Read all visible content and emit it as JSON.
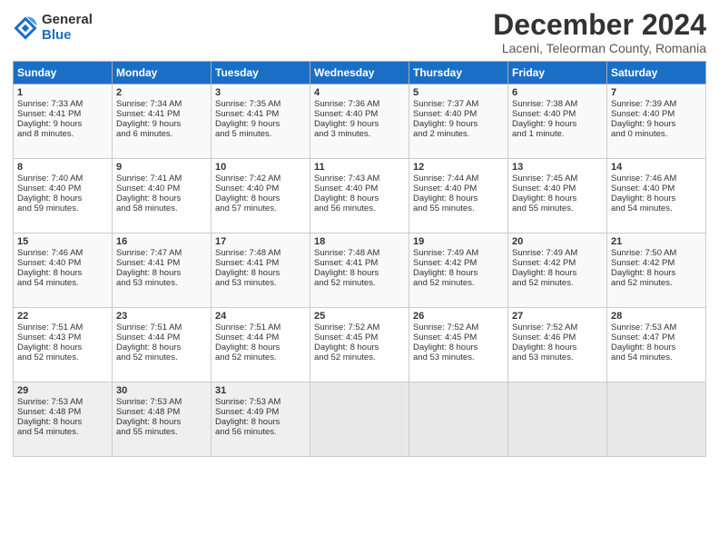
{
  "logo": {
    "general": "General",
    "blue": "Blue"
  },
  "title": "December 2024",
  "location": "Laceni, Teleorman County, Romania",
  "headers": [
    "Sunday",
    "Monday",
    "Tuesday",
    "Wednesday",
    "Thursday",
    "Friday",
    "Saturday"
  ],
  "weeks": [
    [
      {
        "day": "1",
        "lines": [
          "Sunrise: 7:33 AM",
          "Sunset: 4:41 PM",
          "Daylight: 9 hours",
          "and 8 minutes."
        ]
      },
      {
        "day": "2",
        "lines": [
          "Sunrise: 7:34 AM",
          "Sunset: 4:41 PM",
          "Daylight: 9 hours",
          "and 6 minutes."
        ]
      },
      {
        "day": "3",
        "lines": [
          "Sunrise: 7:35 AM",
          "Sunset: 4:41 PM",
          "Daylight: 9 hours",
          "and 5 minutes."
        ]
      },
      {
        "day": "4",
        "lines": [
          "Sunrise: 7:36 AM",
          "Sunset: 4:40 PM",
          "Daylight: 9 hours",
          "and 3 minutes."
        ]
      },
      {
        "day": "5",
        "lines": [
          "Sunrise: 7:37 AM",
          "Sunset: 4:40 PM",
          "Daylight: 9 hours",
          "and 2 minutes."
        ]
      },
      {
        "day": "6",
        "lines": [
          "Sunrise: 7:38 AM",
          "Sunset: 4:40 PM",
          "Daylight: 9 hours",
          "and 1 minute."
        ]
      },
      {
        "day": "7",
        "lines": [
          "Sunrise: 7:39 AM",
          "Sunset: 4:40 PM",
          "Daylight: 9 hours",
          "and 0 minutes."
        ]
      }
    ],
    [
      {
        "day": "8",
        "lines": [
          "Sunrise: 7:40 AM",
          "Sunset: 4:40 PM",
          "Daylight: 8 hours",
          "and 59 minutes."
        ]
      },
      {
        "day": "9",
        "lines": [
          "Sunrise: 7:41 AM",
          "Sunset: 4:40 PM",
          "Daylight: 8 hours",
          "and 58 minutes."
        ]
      },
      {
        "day": "10",
        "lines": [
          "Sunrise: 7:42 AM",
          "Sunset: 4:40 PM",
          "Daylight: 8 hours",
          "and 57 minutes."
        ]
      },
      {
        "day": "11",
        "lines": [
          "Sunrise: 7:43 AM",
          "Sunset: 4:40 PM",
          "Daylight: 8 hours",
          "and 56 minutes."
        ]
      },
      {
        "day": "12",
        "lines": [
          "Sunrise: 7:44 AM",
          "Sunset: 4:40 PM",
          "Daylight: 8 hours",
          "and 55 minutes."
        ]
      },
      {
        "day": "13",
        "lines": [
          "Sunrise: 7:45 AM",
          "Sunset: 4:40 PM",
          "Daylight: 8 hours",
          "and 55 minutes."
        ]
      },
      {
        "day": "14",
        "lines": [
          "Sunrise: 7:46 AM",
          "Sunset: 4:40 PM",
          "Daylight: 8 hours",
          "and 54 minutes."
        ]
      }
    ],
    [
      {
        "day": "15",
        "lines": [
          "Sunrise: 7:46 AM",
          "Sunset: 4:40 PM",
          "Daylight: 8 hours",
          "and 54 minutes."
        ]
      },
      {
        "day": "16",
        "lines": [
          "Sunrise: 7:47 AM",
          "Sunset: 4:41 PM",
          "Daylight: 8 hours",
          "and 53 minutes."
        ]
      },
      {
        "day": "17",
        "lines": [
          "Sunrise: 7:48 AM",
          "Sunset: 4:41 PM",
          "Daylight: 8 hours",
          "and 53 minutes."
        ]
      },
      {
        "day": "18",
        "lines": [
          "Sunrise: 7:48 AM",
          "Sunset: 4:41 PM",
          "Daylight: 8 hours",
          "and 52 minutes."
        ]
      },
      {
        "day": "19",
        "lines": [
          "Sunrise: 7:49 AM",
          "Sunset: 4:42 PM",
          "Daylight: 8 hours",
          "and 52 minutes."
        ]
      },
      {
        "day": "20",
        "lines": [
          "Sunrise: 7:49 AM",
          "Sunset: 4:42 PM",
          "Daylight: 8 hours",
          "and 52 minutes."
        ]
      },
      {
        "day": "21",
        "lines": [
          "Sunrise: 7:50 AM",
          "Sunset: 4:42 PM",
          "Daylight: 8 hours",
          "and 52 minutes."
        ]
      }
    ],
    [
      {
        "day": "22",
        "lines": [
          "Sunrise: 7:51 AM",
          "Sunset: 4:43 PM",
          "Daylight: 8 hours",
          "and 52 minutes."
        ]
      },
      {
        "day": "23",
        "lines": [
          "Sunrise: 7:51 AM",
          "Sunset: 4:44 PM",
          "Daylight: 8 hours",
          "and 52 minutes."
        ]
      },
      {
        "day": "24",
        "lines": [
          "Sunrise: 7:51 AM",
          "Sunset: 4:44 PM",
          "Daylight: 8 hours",
          "and 52 minutes."
        ]
      },
      {
        "day": "25",
        "lines": [
          "Sunrise: 7:52 AM",
          "Sunset: 4:45 PM",
          "Daylight: 8 hours",
          "and 52 minutes."
        ]
      },
      {
        "day": "26",
        "lines": [
          "Sunrise: 7:52 AM",
          "Sunset: 4:45 PM",
          "Daylight: 8 hours",
          "and 53 minutes."
        ]
      },
      {
        "day": "27",
        "lines": [
          "Sunrise: 7:52 AM",
          "Sunset: 4:46 PM",
          "Daylight: 8 hours",
          "and 53 minutes."
        ]
      },
      {
        "day": "28",
        "lines": [
          "Sunrise: 7:53 AM",
          "Sunset: 4:47 PM",
          "Daylight: 8 hours",
          "and 54 minutes."
        ]
      }
    ],
    [
      {
        "day": "29",
        "lines": [
          "Sunrise: 7:53 AM",
          "Sunset: 4:48 PM",
          "Daylight: 8 hours",
          "and 54 minutes."
        ]
      },
      {
        "day": "30",
        "lines": [
          "Sunrise: 7:53 AM",
          "Sunset: 4:48 PM",
          "Daylight: 8 hours",
          "and 55 minutes."
        ]
      },
      {
        "day": "31",
        "lines": [
          "Sunrise: 7:53 AM",
          "Sunset: 4:49 PM",
          "Daylight: 8 hours",
          "and 56 minutes."
        ]
      },
      null,
      null,
      null,
      null
    ]
  ]
}
